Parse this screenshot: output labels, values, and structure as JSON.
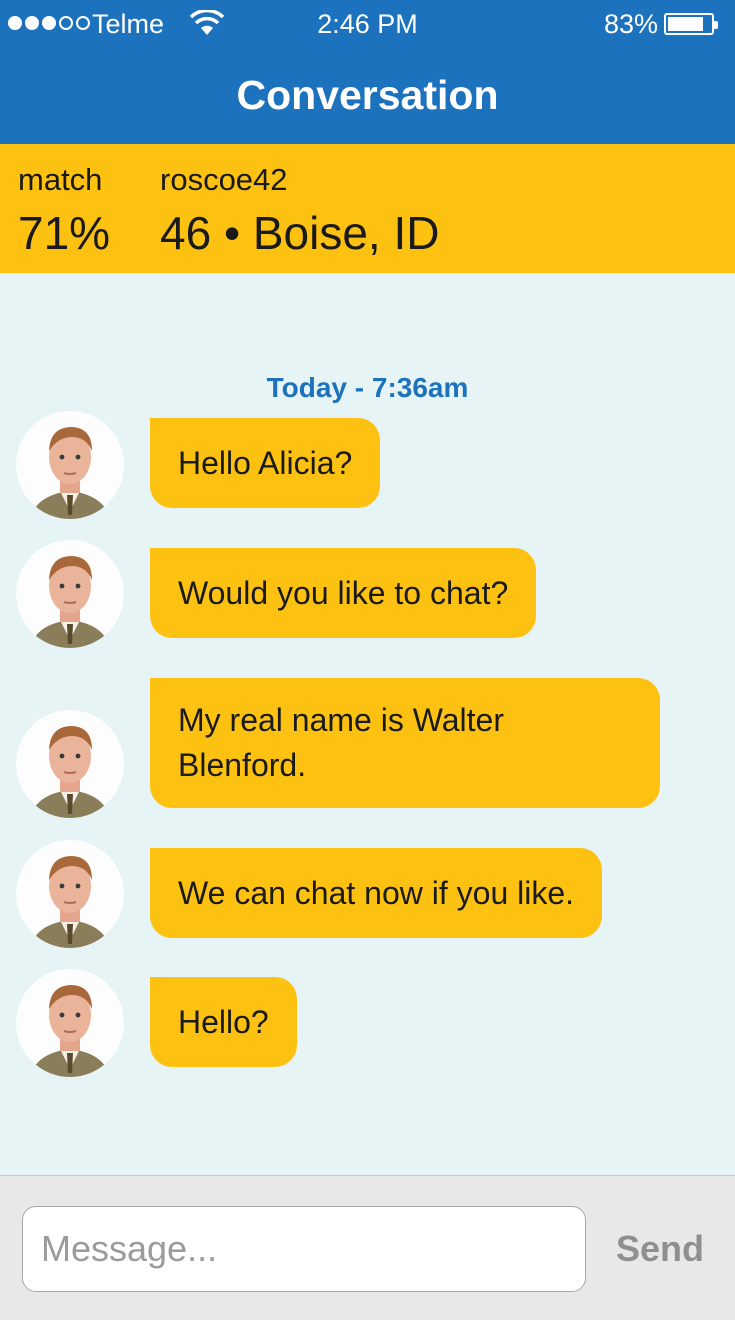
{
  "status_bar": {
    "carrier": "Telme",
    "time": "2:46 PM",
    "battery_percent": "83%",
    "signal_bars_filled": 3,
    "signal_bars_total": 5
  },
  "nav": {
    "title": "Conversation"
  },
  "profile": {
    "match_label": "match",
    "match_value": "71%",
    "username": "roscoe42",
    "details": "46 • Boise, ID"
  },
  "chat": {
    "timestamp": "Today - 7:36am",
    "messages": [
      {
        "text": "Hello Alicia?"
      },
      {
        "text": "Would you like to chat?"
      },
      {
        "text": "My real name is Walter Blenford."
      },
      {
        "text": "We can chat now if you like."
      },
      {
        "text": "Hello?"
      }
    ]
  },
  "composer": {
    "placeholder": "Message...",
    "value": "",
    "send_label": "Send"
  },
  "colors": {
    "nav_blue": "#1d72bd",
    "accent_yellow": "#fdc112",
    "chat_background": "#e6f4f5"
  }
}
